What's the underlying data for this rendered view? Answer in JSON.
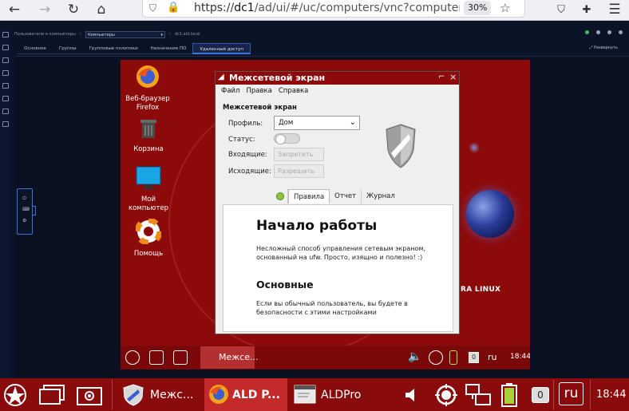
{
  "browser": {
    "url_prefix": "https://",
    "url_host": "dc1",
    "url_path": "/ad/ui/#/uc/computers/vnc?computerId",
    "zoom": "30%"
  },
  "app": {
    "breadcrumb_root": "Пользователи и компьютеры",
    "breadcrumb_select": "Компьютеры",
    "breadcrumb_domain": "dc1.ald.local",
    "tabs": [
      {
        "label": "Основное"
      },
      {
        "label": "Группы"
      },
      {
        "label": "Групповые политики"
      },
      {
        "label": "Назначение ПО"
      },
      {
        "label": "Удаленный доступ"
      }
    ],
    "fullscreen_label": "Развернуть"
  },
  "remote": {
    "desktop_icons": [
      {
        "label": "Веб-браузер Firefox",
        "icon": "firefox-icon"
      },
      {
        "label": "Корзина",
        "icon": "trash-icon"
      },
      {
        "label": "Мой компьютер",
        "icon": "monitor-icon"
      },
      {
        "label": "Помощь",
        "icon": "help-lifebuoy-icon"
      }
    ],
    "brand": "RA LINUX",
    "firewall": {
      "title": "Межсетевой экран",
      "menu": [
        "Файл",
        "Правка",
        "Справка"
      ],
      "heading": "Межсетевой экран",
      "profile_label": "Профиль:",
      "profile_value": "Дом",
      "status_label": "Статус:",
      "incoming_label": "Входящие:",
      "incoming_value": "Запретить",
      "outgoing_label": "Исходящие:",
      "outgoing_value": "Разрешить",
      "tabs": [
        "Правила",
        "Отчет",
        "Журнал"
      ],
      "content_h1": "Начало работы",
      "content_p1": "Несложный способ управления сетевым экраном, основанный на ufw. Просто, изящно и полезно! :)",
      "content_h2": "Основные",
      "content_p2": "Если вы обычный пользователь, вы будете в безопасности с этими настройками"
    },
    "taskbar": {
      "active_window": "Межсе...",
      "count": "0",
      "lang": "ru",
      "clock": "18:44"
    }
  },
  "host_taskbar": {
    "window1": "Межс...",
    "window2": "ALD P...",
    "window3": "ALDPro",
    "count": "0",
    "lang": "ru",
    "clock": "18:44"
  }
}
